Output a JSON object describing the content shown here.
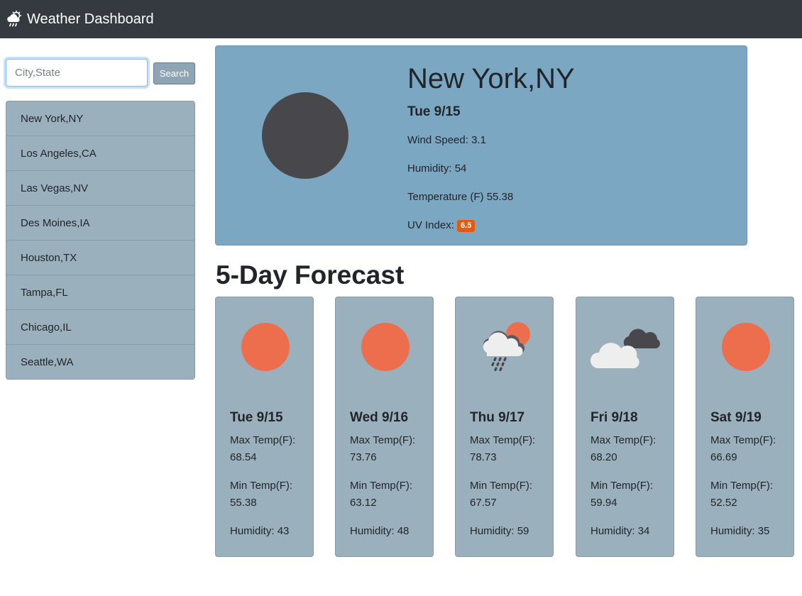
{
  "navbar": {
    "title": "Weather Dashboard"
  },
  "search": {
    "placeholder": "City,State",
    "button_label": "Search"
  },
  "cities": [
    "New York,NY",
    "Los Angeles,CA",
    "Las Vegas,NV",
    "Des Moines,IA",
    "Houston,TX",
    "Tampa,FL",
    "Chicago,IL",
    "Seattle,WA"
  ],
  "current": {
    "city": "New York,NY",
    "date": "Tue 9/15",
    "wind_label": "Wind Speed:",
    "wind": "3.1",
    "humidity_label": "Humidity:",
    "humidity": "54",
    "temp_label": "Temperature (F)",
    "temp": "55.38",
    "uv_label": "UV Index:",
    "uv": "6.5",
    "icon": "moon-icon"
  },
  "forecast_heading": "5-Day Forecast",
  "labels": {
    "max": "Max Temp(F):",
    "min": "Min Temp(F):",
    "humidity": "Humidity:"
  },
  "forecast": [
    {
      "date": "Tue 9/15",
      "max": "68.54",
      "min": "55.38",
      "humidity": "43",
      "icon": "sun-icon"
    },
    {
      "date": "Wed 9/16",
      "max": "73.76",
      "min": "63.12",
      "humidity": "48",
      "icon": "sun-icon"
    },
    {
      "date": "Thu 9/17",
      "max": "78.73",
      "min": "67.57",
      "humidity": "59",
      "icon": "rain-sun-icon"
    },
    {
      "date": "Fri 9/18",
      "max": "68.20",
      "min": "59.94",
      "humidity": "34",
      "icon": "cloudy-icon"
    },
    {
      "date": "Sat 9/19",
      "max": "66.69",
      "min": "52.52",
      "humidity": "35",
      "icon": "sun-icon"
    }
  ],
  "colors": {
    "navbar": "#343a40",
    "card_current": "#7ba7c2",
    "card_forecast": "#9bb0bd",
    "sun": "#ec6e4c",
    "uv_badge": "#e8590c"
  }
}
